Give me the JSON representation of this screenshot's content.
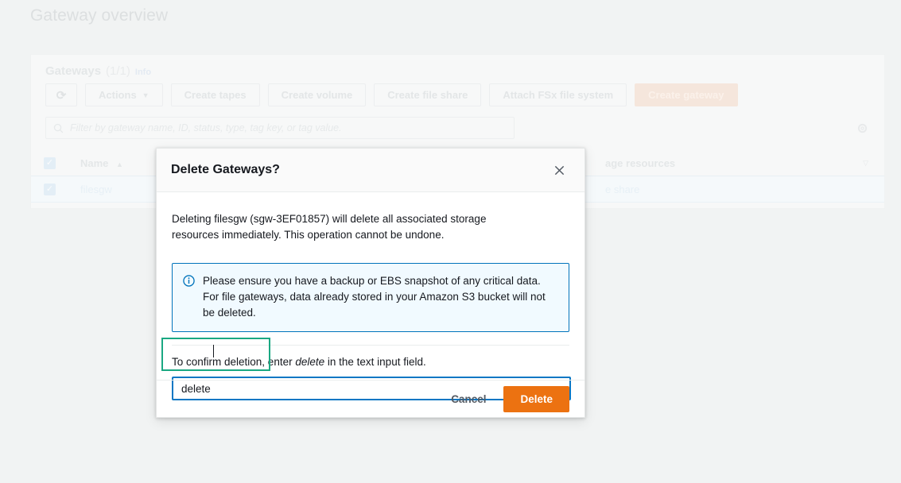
{
  "background": {
    "page_title": "Gateway overview",
    "panel": {
      "title": "Gateways",
      "count": "(1/1)",
      "info_link": "Info"
    },
    "toolbar": {
      "refresh_icon": "refresh-icon",
      "actions_label": "Actions",
      "actions_caret": "▼",
      "create_tapes_label": "Create tapes",
      "create_volume_label": "Create volume",
      "create_file_share_label": "Create file share",
      "attach_fsx_label": "Attach FSx file system",
      "create_gateway_label": "Create gateway"
    },
    "filter": {
      "placeholder": "Filter by gateway name, ID, status, type, tag key, or tag value.",
      "search_icon": "search-icon",
      "settings_icon": "gear-icon"
    },
    "table": {
      "select_all_checked": "✓",
      "columns": {
        "name": "Name",
        "storage_resources": "age resources",
        "sort_arrow": "▲",
        "filter_arrow": "▽"
      },
      "rows": [
        {
          "checked": "✓",
          "name": "filesgw",
          "storage_resources": "e share"
        }
      ]
    }
  },
  "modal": {
    "title": "Delete Gateways?",
    "close_icon": "✕",
    "description": "Deleting filesgw (sgw-3EF01857) will delete all associated storage resources immediately. This operation cannot be undone.",
    "alert": {
      "icon": "info-icon",
      "text": "Please ensure you have a backup or EBS snapshot of any critical data. For file gateways, data already stored in your Amazon S3 bucket will not be deleted.",
      "border_color": "#0073bb",
      "background_color": "#f1faff"
    },
    "confirm": {
      "label_before": "To confirm deletion, enter ",
      "label_emphasis": "delete",
      "label_after": " in the text input field.",
      "input_value": "delete",
      "input_placeholder": "",
      "input_border_color": "#0a77c4"
    },
    "annotation": {
      "highlight_color": "#1aa882"
    },
    "footer": {
      "cancel_label": "Cancel",
      "delete_label": "Delete",
      "delete_color": "#ec7211"
    }
  }
}
